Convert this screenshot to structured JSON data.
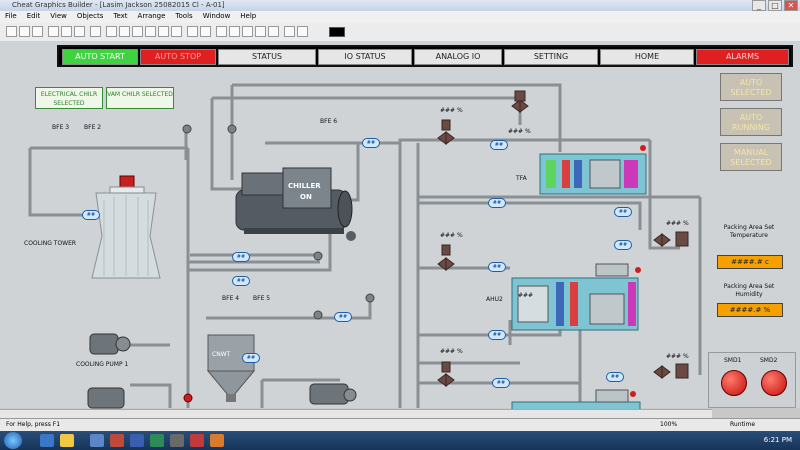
{
  "window": {
    "title": "Cheat Graphics Builder - [Lasim Jackson 25082015 Cl - A-01]",
    "minimize_glyph": "_",
    "maximize_glyph": "□",
    "close_glyph": "✕"
  },
  "menu": [
    "File",
    "Edit",
    "View",
    "Objects",
    "Text",
    "Arrange",
    "Tools",
    "Window",
    "Help"
  ],
  "nav": {
    "auto_start": "AUTO START",
    "auto_stop": "AUTO STOP",
    "status": "STATUS",
    "io_status": "IO STATUS",
    "analog_io": "ANALOG IO",
    "setting": "SETTING",
    "home": "HOME",
    "alarms": "ALARMS"
  },
  "side": {
    "auto_selected": "AUTO SELECTED",
    "auto_running": "AUTO RUNNING",
    "manual_selected": "MANUAL SELECTED"
  },
  "packing": {
    "temp_label": "Packing Area Set Temperature",
    "temp_value": "####.#",
    "temp_unit": "c",
    "hum_label": "Packing Area Set Humidity",
    "hum_value": "####.#",
    "hum_unit": "%",
    "smd1": "SMD1",
    "smd2": "SMD2"
  },
  "plant": {
    "electrical_chiller": "ELECTRICAL CHILR SELECTED",
    "vam_chiller": "VAM CHILR SELECTED",
    "bfe3": "BFE 3",
    "bfe2": "BFE 2",
    "bfe6": "BFE 6",
    "bfe4": "BFE 4",
    "bfe5": "BFE 5",
    "cooling_tower": "COOLING TOWER",
    "chiller": "CHILLER",
    "chiller_state": "ON",
    "cooling_pump": "COOLING PUMP 1",
    "ahu2": "AHU2",
    "tfa": "TFA",
    "cnwt": "CNWT",
    "gauge": "##",
    "pct": "### %",
    "hash": "###"
  },
  "statusbar": {
    "left": "For Help, press F1",
    "zoom": "100%",
    "mode": "Runtime"
  },
  "taskbar": {
    "time": "6:21 PM"
  }
}
